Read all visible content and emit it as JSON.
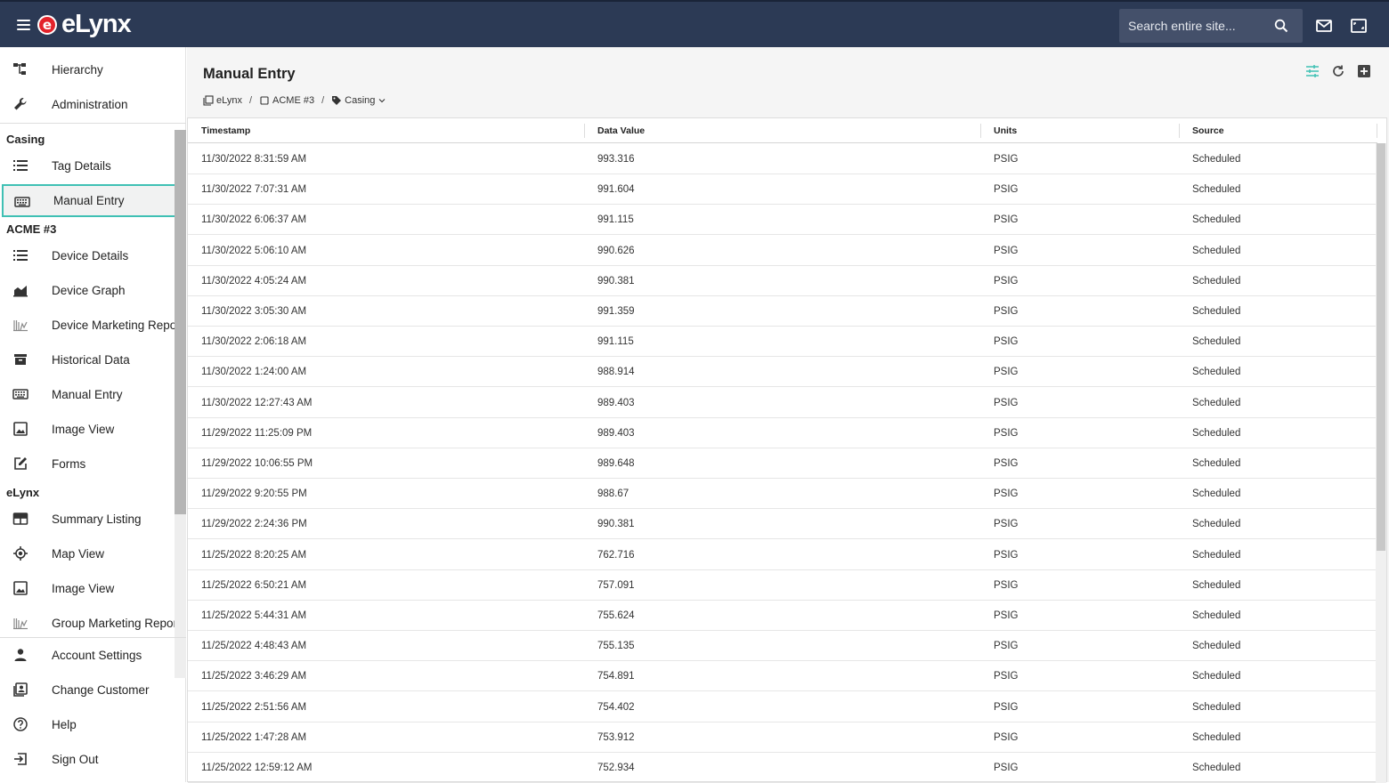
{
  "app": {
    "brand": "eLynx",
    "logo_mark": "e",
    "logo_text": "eLynx"
  },
  "header": {
    "search_placeholder": "Search entire site..."
  },
  "sidebar": {
    "top_items": [
      {
        "label": "Hierarchy",
        "icon": "hierarchy-icon"
      },
      {
        "label": "Administration",
        "icon": "wrench-icon"
      }
    ],
    "sections": [
      {
        "title": "Casing",
        "items": [
          {
            "label": "Tag Details",
            "icon": "list-icon"
          },
          {
            "label": "Manual Entry",
            "icon": "keyboard-icon",
            "active": true
          }
        ]
      },
      {
        "title": "ACME #3",
        "items": [
          {
            "label": "Device Details",
            "icon": "list-icon"
          },
          {
            "label": "Device Graph",
            "icon": "area-chart-icon"
          },
          {
            "label": "Device Marketing Report",
            "icon": "report-icon"
          },
          {
            "label": "Historical Data",
            "icon": "archive-icon"
          },
          {
            "label": "Manual Entry",
            "icon": "keyboard-icon"
          },
          {
            "label": "Image View",
            "icon": "image-icon"
          },
          {
            "label": "Forms",
            "icon": "edit-icon"
          }
        ]
      },
      {
        "title": "eLynx",
        "items": [
          {
            "label": "Summary Listing",
            "icon": "table-icon"
          },
          {
            "label": "Map View",
            "icon": "location-icon"
          },
          {
            "label": "Image View",
            "icon": "image-icon"
          },
          {
            "label": "Group Marketing Report",
            "icon": "report-icon"
          }
        ]
      }
    ],
    "bottom_items": [
      {
        "label": "Account Settings",
        "icon": "person-icon"
      },
      {
        "label": "Change Customer",
        "icon": "contacts-icon"
      },
      {
        "label": "Help",
        "icon": "help-icon"
      },
      {
        "label": "Sign Out",
        "icon": "sign-out-icon"
      }
    ]
  },
  "main": {
    "title": "Manual Entry",
    "breadcrumbs": [
      {
        "label": "eLynx",
        "icon": "folders-icon"
      },
      {
        "label": "ACME #3",
        "icon": "square-icon"
      },
      {
        "label": "Casing",
        "icon": "tag-icon",
        "dropdown": true
      }
    ],
    "breadcrumb_separator": "/",
    "table": {
      "columns": [
        "Timestamp",
        "Data Value",
        "Units",
        "Source"
      ],
      "rows": [
        [
          "11/30/2022 8:31:59 AM",
          "993.316",
          "PSIG",
          "Scheduled"
        ],
        [
          "11/30/2022 7:07:31 AM",
          "991.604",
          "PSIG",
          "Scheduled"
        ],
        [
          "11/30/2022 6:06:37 AM",
          "991.115",
          "PSIG",
          "Scheduled"
        ],
        [
          "11/30/2022 5:06:10 AM",
          "990.626",
          "PSIG",
          "Scheduled"
        ],
        [
          "11/30/2022 4:05:24 AM",
          "990.381",
          "PSIG",
          "Scheduled"
        ],
        [
          "11/30/2022 3:05:30 AM",
          "991.359",
          "PSIG",
          "Scheduled"
        ],
        [
          "11/30/2022 2:06:18 AM",
          "991.115",
          "PSIG",
          "Scheduled"
        ],
        [
          "11/30/2022 1:24:00 AM",
          "988.914",
          "PSIG",
          "Scheduled"
        ],
        [
          "11/30/2022 12:27:43 AM",
          "989.403",
          "PSIG",
          "Scheduled"
        ],
        [
          "11/29/2022 11:25:09 PM",
          "989.403",
          "PSIG",
          "Scheduled"
        ],
        [
          "11/29/2022 10:06:55 PM",
          "989.648",
          "PSIG",
          "Scheduled"
        ],
        [
          "11/29/2022 9:20:55 PM",
          "988.67",
          "PSIG",
          "Scheduled"
        ],
        [
          "11/29/2022 2:24:36 PM",
          "990.381",
          "PSIG",
          "Scheduled"
        ],
        [
          "11/25/2022 8:20:25 AM",
          "762.716",
          "PSIG",
          "Scheduled"
        ],
        [
          "11/25/2022 6:50:21 AM",
          "757.091",
          "PSIG",
          "Scheduled"
        ],
        [
          "11/25/2022 5:44:31 AM",
          "755.624",
          "PSIG",
          "Scheduled"
        ],
        [
          "11/25/2022 4:48:43 AM",
          "755.135",
          "PSIG",
          "Scheduled"
        ],
        [
          "11/25/2022 3:46:29 AM",
          "754.891",
          "PSIG",
          "Scheduled"
        ],
        [
          "11/25/2022 2:51:56 AM",
          "754.402",
          "PSIG",
          "Scheduled"
        ],
        [
          "11/25/2022 1:47:28 AM",
          "753.912",
          "PSIG",
          "Scheduled"
        ],
        [
          "11/25/2022 12:59:12 AM",
          "752.934",
          "PSIG",
          "Scheduled"
        ]
      ]
    }
  },
  "colors": {
    "topbar": "#2c3a55",
    "accent": "#3fc0b4",
    "brand_red": "#e3232b"
  }
}
